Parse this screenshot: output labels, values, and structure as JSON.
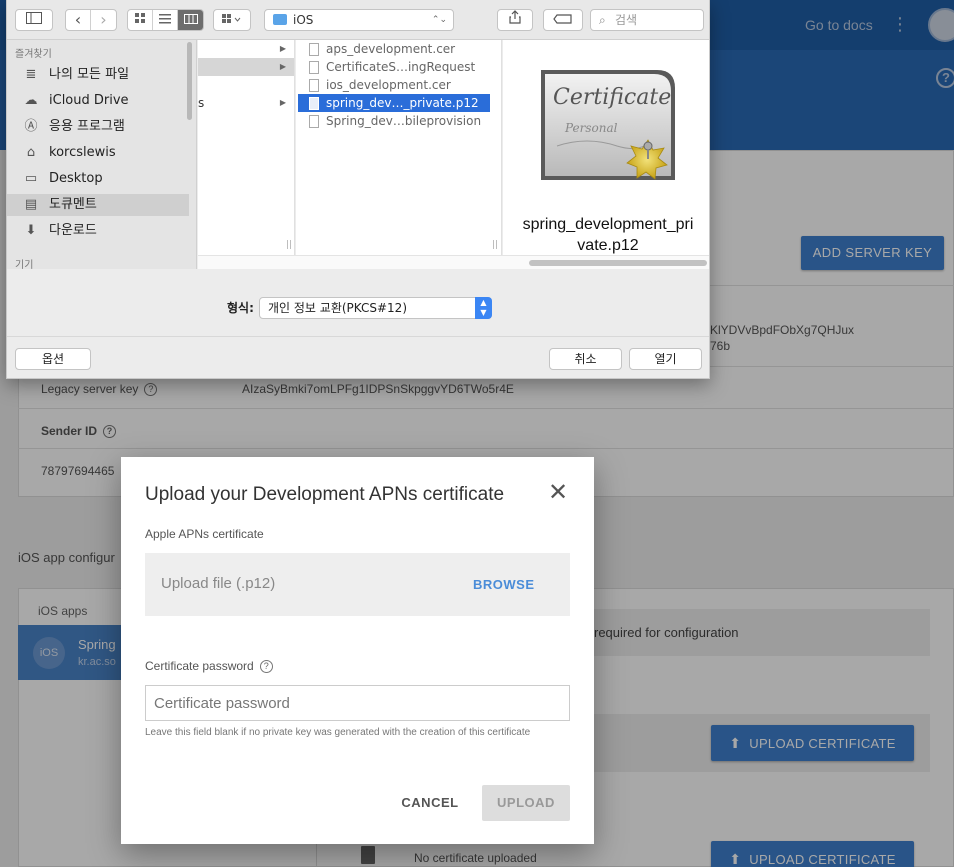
{
  "background": {
    "topbar": {
      "go_to_docs": "Go to docs",
      "kebab": "⋮",
      "help": "?",
      "tab_fragment": "s"
    },
    "add_server_key": "ADD SERVER KEY",
    "server_key_fragment_line1": "KlYDVvBpdFObXg7QHJux",
    "server_key_fragment_line2": "76b",
    "legacy_server_key_label": "Legacy server key",
    "legacy_server_key_value": "AIzaSyBmki7omLPFg1IDPSnSkpggvYD6TWo5r4E",
    "sender_id_label": "Sender ID",
    "sender_id_value": "78797694465",
    "help_glyph": "?",
    "ios_app_configuration": "iOS app configur",
    "ios_apps_label": "iOS apps",
    "app_badge": "iOS",
    "app_name": "Spring",
    "app_bundle": "kr.ac.so",
    "required_notice": "required for configuration",
    "upload_certificate": "UPLOAD CERTIFICATE",
    "upload_arrow": "⬆",
    "no_certificate": "No certificate uploaded"
  },
  "dialog": {
    "title": "Upload your Development APNs certificate",
    "close_glyph": "✕",
    "apns_label": "Apple APNs certificate",
    "upload_placeholder": "Upload file (.p12)",
    "browse": "BROWSE",
    "password_label": "Certificate password",
    "help_glyph": "?",
    "password_placeholder": "Certificate password",
    "password_hint": "Leave this field blank if no private key was generated with the creation of this certificate",
    "cancel": "CANCEL",
    "upload": "UPLOAD"
  },
  "file_panel": {
    "toolbar": {
      "back": "‹",
      "forward": "›",
      "path_folder": "iOS",
      "path_stepper": "⌃⌄",
      "search_placeholder": "검색",
      "search_icon": "⌕"
    },
    "sidebar": {
      "favorites_header": "즐겨찾기",
      "items": [
        {
          "label": "나의 모든 파일",
          "icon": "≣"
        },
        {
          "label": "iCloud Drive",
          "icon": "☁"
        },
        {
          "label": "응용 프로그램",
          "icon": "Ⓐ"
        },
        {
          "label": "korcslewis",
          "icon": "⌂"
        },
        {
          "label": "Desktop",
          "icon": "▭"
        },
        {
          "label": "도큐멘트",
          "icon": "▤"
        },
        {
          "label": "다운로드",
          "icon": "⬇"
        }
      ],
      "devices_header": "기기"
    },
    "column1": {
      "fragment": "s"
    },
    "files": [
      {
        "name": "aps_development.cer"
      },
      {
        "name": "CertificateS…ingRequest"
      },
      {
        "name": "ios_development.cer"
      },
      {
        "name": "spring_dev…_private.p12",
        "selected": true
      },
      {
        "name": "Spring_dev…bileprovision"
      }
    ],
    "preview": {
      "name_line1": "spring_development_pri",
      "name_line2": "vate.p12",
      "cert_title": "Certificate",
      "cert_sub": "Personal"
    },
    "format_label": "형식:",
    "format_value": "개인 정보 교환(PKCS#12)",
    "options": "옵션",
    "cancel": "취소",
    "open": "열기"
  }
}
